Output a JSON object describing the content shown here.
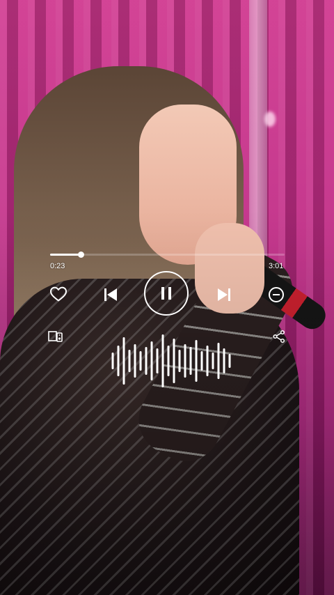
{
  "player": {
    "current_time": "0:23",
    "total_time": "3:01",
    "progress": 0.13,
    "state": "playing"
  },
  "controls": {
    "like_icon": "heart-outline-icon",
    "prev_icon": "skip-previous-icon",
    "play_pause_icon": "pause-icon",
    "next_icon": "skip-next-icon",
    "remove_icon": "minus-circle-icon",
    "device_icon": "devices-icon",
    "share_icon": "share-icon"
  },
  "visualizer": {
    "levels": [
      0.3,
      0.55,
      0.85,
      0.4,
      0.6,
      0.35,
      0.5,
      0.7,
      0.45,
      0.95,
      0.55,
      0.8,
      0.4,
      0.6,
      0.5,
      0.75,
      0.35,
      0.55,
      0.3,
      0.65,
      0.45,
      0.25
    ]
  },
  "colors": {
    "overlay_fg": "#ffffff",
    "background_accent": "#c12c86"
  }
}
